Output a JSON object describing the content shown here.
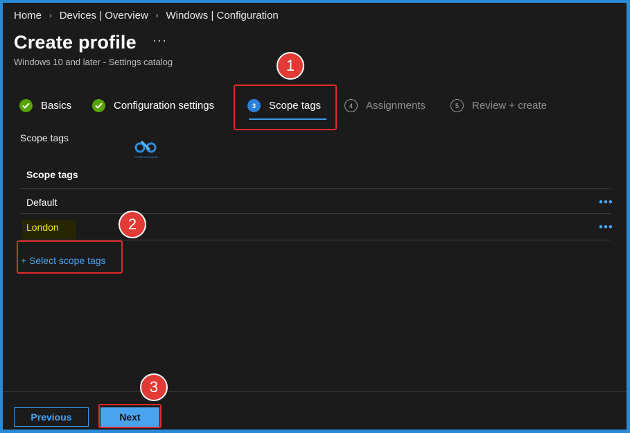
{
  "breadcrumb": {
    "items": [
      "Home",
      "Devices | Overview",
      "Windows | Configuration"
    ],
    "separator": "›"
  },
  "header": {
    "title": "Create profile",
    "more": "···",
    "subtitle": "Windows 10 and later - Settings catalog"
  },
  "steps": [
    {
      "label": "Basics",
      "state": "done"
    },
    {
      "label": "Configuration settings",
      "state": "done"
    },
    {
      "label": "Scope tags",
      "number": "3",
      "state": "active"
    },
    {
      "label": "Assignments",
      "number": "4",
      "state": "pending"
    },
    {
      "label": "Review + create",
      "number": "5",
      "state": "pending"
    }
  ],
  "scope_section": {
    "label": "Scope tags",
    "column_header": "Scope tags",
    "rows": [
      "Default",
      "London"
    ],
    "row_more": "•••",
    "select_link": "+ Select scope tags"
  },
  "logo": {
    "text": "HTMD Community"
  },
  "callouts": [
    "1",
    "2",
    "3"
  ],
  "footer": {
    "previous_label": "Previous",
    "next_label": "Next"
  },
  "colors": {
    "accent": "#3d9be9",
    "check_green": "#57a300",
    "callout_red": "#e23a35",
    "highlight_yellow": "#f2e600",
    "frame_blue": "#2a8ad8"
  }
}
